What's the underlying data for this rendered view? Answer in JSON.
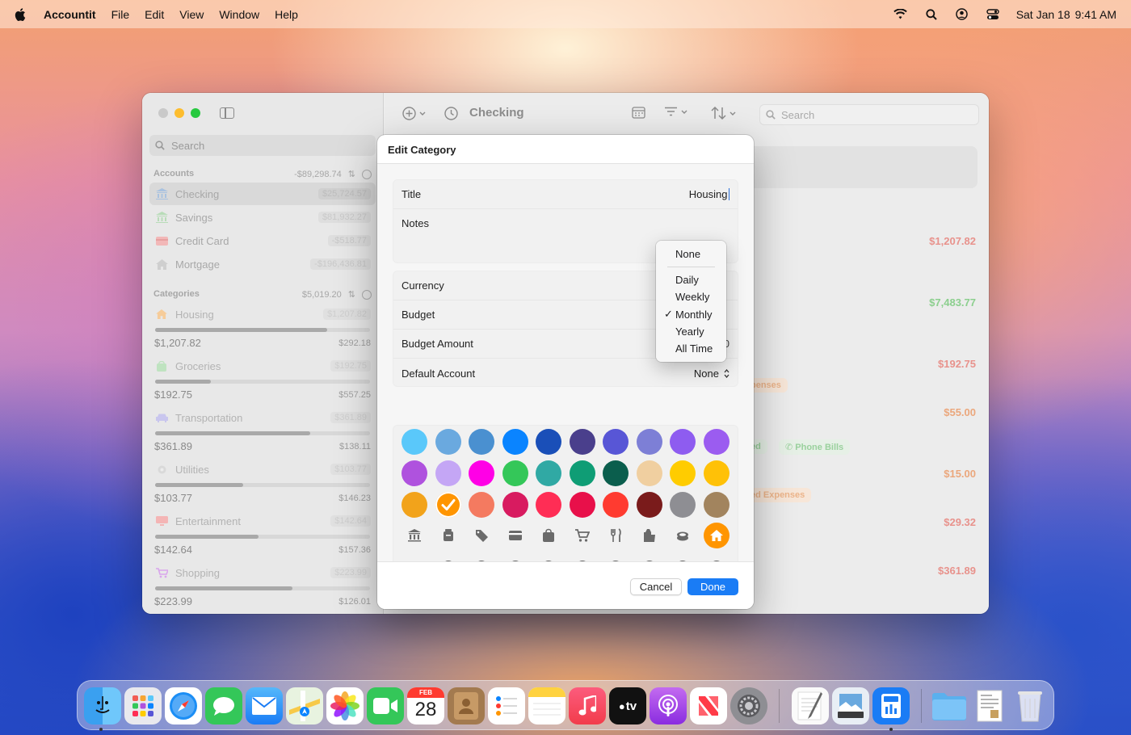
{
  "menubar": {
    "app_name": "Accountit",
    "items": [
      "File",
      "Edit",
      "View",
      "Window",
      "Help"
    ],
    "date": "Sat Jan 18",
    "time": "9:41 AM"
  },
  "sidebar": {
    "search_placeholder": "Search",
    "accounts_header": "Accounts",
    "accounts_total": "-$89,298.74",
    "accounts": [
      {
        "label": "Checking",
        "value": "$25,724.57"
      },
      {
        "label": "Savings",
        "value": "$81,932.27"
      },
      {
        "label": "Credit Card",
        "value": "-$518.77"
      },
      {
        "label": "Mortgage",
        "value": "-$196,436.81"
      }
    ],
    "categories_header": "Categories",
    "categories_total": "$5,019.20",
    "categories": [
      {
        "label": "Housing",
        "value": "$1,207.82",
        "spent": "$1,207.82",
        "remaining": "$292.18",
        "progress": 0.8
      },
      {
        "label": "Groceries",
        "value": "$192.75",
        "spent": "$192.75",
        "remaining": "$557.25",
        "progress": 0.26
      },
      {
        "label": "Transportation",
        "value": "$361.89",
        "spent": "$361.89",
        "remaining": "$138.11",
        "progress": 0.72
      },
      {
        "label": "Utilities",
        "value": "$103.77",
        "spent": "$103.77",
        "remaining": "$146.23",
        "progress": 0.41
      },
      {
        "label": "Entertainment",
        "value": "$142.64",
        "spent": "$142.64",
        "remaining": "$157.36",
        "progress": 0.48
      },
      {
        "label": "Shopping",
        "value": "$223.99",
        "spent": "$223.99",
        "remaining": "$126.01",
        "progress": 0.64
      }
    ]
  },
  "toolbar": {
    "title": "Checking",
    "search_placeholder": "Search"
  },
  "transactions": {
    "amounts": [
      "$1,207.82",
      "$7,483.77",
      "$192.75",
      "$55.00",
      "$15.00",
      "$29.32",
      "$361.89"
    ],
    "chips": [
      "penses",
      "ed",
      "Phone Bills",
      "ed Expenses"
    ],
    "colors": {
      "expense": "#e5706a",
      "income": "#63b56a",
      "orange": "#f0a23a"
    }
  },
  "dialog": {
    "title": "Edit Category",
    "title_label": "Title",
    "title_value": "Housing",
    "notes_label": "Notes",
    "currency_label": "Currency",
    "budget_label": "Budget",
    "budget_amount_label": "Budget Amount",
    "budget_amount_partial": "0",
    "default_account_label": "Default Account",
    "default_account_value": "None",
    "cancel_label": "Cancel",
    "done_label": "Done",
    "colors": [
      "#5ac8fa",
      "#6aa9df",
      "#4a90d0",
      "#0a84ff",
      "#1a4fb8",
      "#4a3f8c",
      "#5856d6",
      "#7d7fd6",
      "#8e5cf0",
      "#9b5cf0",
      "#af52de",
      "#c4a6f5",
      "#ff00e6",
      "#34c759",
      "#30a9a4",
      "#0f9d75",
      "#0b5e4d",
      "#f0cfa0",
      "#ffcc00",
      "#ffc107",
      "#f2a31b",
      "#ff9500",
      "#f47a60",
      "#d81b60",
      "#ff2d55",
      "#e8104a",
      "#ff3b30",
      "#7a1b1b",
      "#8e8e93",
      "#a2845e"
    ],
    "selected_color": "#ff9500",
    "icons": [
      "bank-icon",
      "piggy-bank-icon",
      "tag-icon",
      "credit-card-icon",
      "bag-icon",
      "cart-icon",
      "fork-knife-icon",
      "gift-icon",
      "money-stack-icon",
      "house-icon"
    ],
    "currency_coins": [
      "$",
      "¥",
      "£",
      "₣",
      "₺",
      "₱",
      "€",
      "₫",
      "₹"
    ],
    "recurring_icon": "recurring-arrows-icon",
    "selected_icon": "house-icon"
  },
  "budget_menu": {
    "options": [
      "None",
      "Daily",
      "Weekly",
      "Monthly",
      "Yearly",
      "All Time"
    ],
    "selected": "Monthly"
  },
  "dock": {
    "apps": [
      "Finder",
      "Launchpad",
      "Safari",
      "Messages",
      "Mail",
      "Maps",
      "Photos",
      "FaceTime",
      "Calendar",
      "Contacts",
      "Reminders",
      "Notes",
      "Music",
      "TV",
      "Podcasts",
      "News",
      "System Settings",
      "TextEdit",
      "Preview",
      "Accountit",
      "Folder",
      "Document",
      "Trash"
    ],
    "calendar_month": "FEB",
    "calendar_day": "28",
    "tv_label": "tv"
  }
}
